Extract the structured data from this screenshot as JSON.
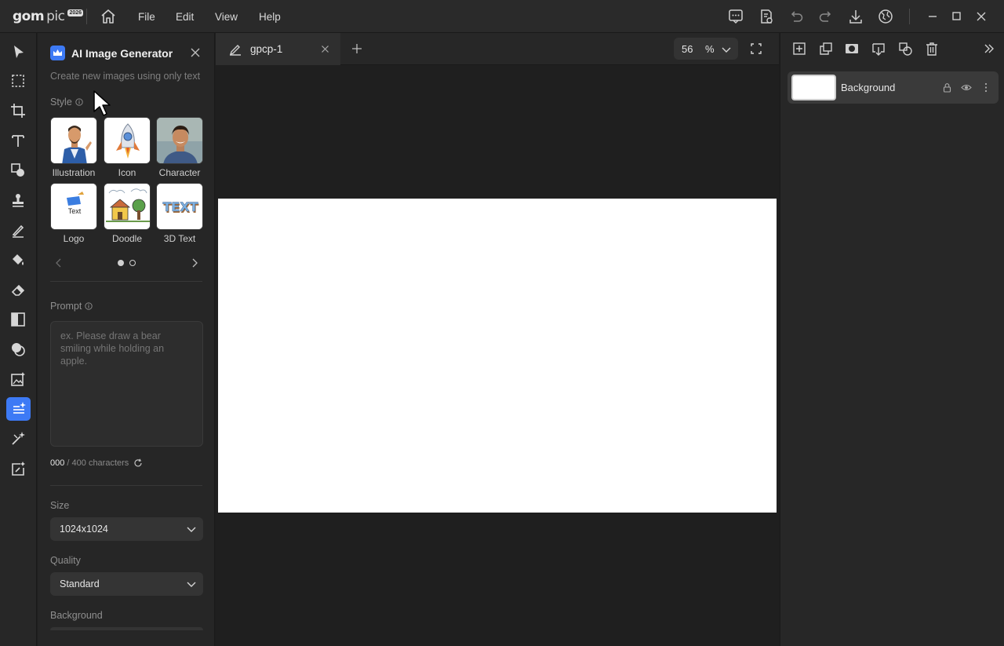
{
  "app": {
    "logo": {
      "name": "gom",
      "suffix": "pic",
      "badge": "2026"
    },
    "menu": [
      "File",
      "Edit",
      "View",
      "Help"
    ]
  },
  "panel": {
    "title": "AI Image Generator",
    "subtitle": "Create new images using only text",
    "style_label": "Style",
    "styles": [
      {
        "label": "Illustration",
        "icon": "illustration-man-thumbnail"
      },
      {
        "label": "Icon",
        "icon": "rocket-thumbnail"
      },
      {
        "label": "Character",
        "icon": "character-photo-thumbnail"
      },
      {
        "label": "Logo",
        "icon": "text-logo-thumbnail"
      },
      {
        "label": "Doodle",
        "icon": "doodle-house-thumbnail"
      },
      {
        "label": "3D Text",
        "icon": "3d-text-thumbnail"
      }
    ],
    "logo_thumb_text": "Text",
    "text3d_thumb_text": "TEXT",
    "pager": {
      "pages": 2,
      "current": 1
    },
    "prompt_label": "Prompt",
    "prompt_placeholder": "ex. Please draw a bear smiling while holding an apple.",
    "char_count": "000",
    "char_limit": "/ 400 characters",
    "size_label": "Size",
    "size_value": "1024x1024",
    "quality_label": "Quality",
    "quality_value": "Standard",
    "background_label": "Background"
  },
  "tabs": [
    {
      "title": "gpcp-1"
    }
  ],
  "zoom": {
    "value": "56",
    "unit": "%"
  },
  "layers": [
    {
      "name": "Background"
    }
  ],
  "colors": {
    "accent": "#3d7af5",
    "canvas_bg": "#1f1f1f",
    "panel_bg": "#262626"
  }
}
